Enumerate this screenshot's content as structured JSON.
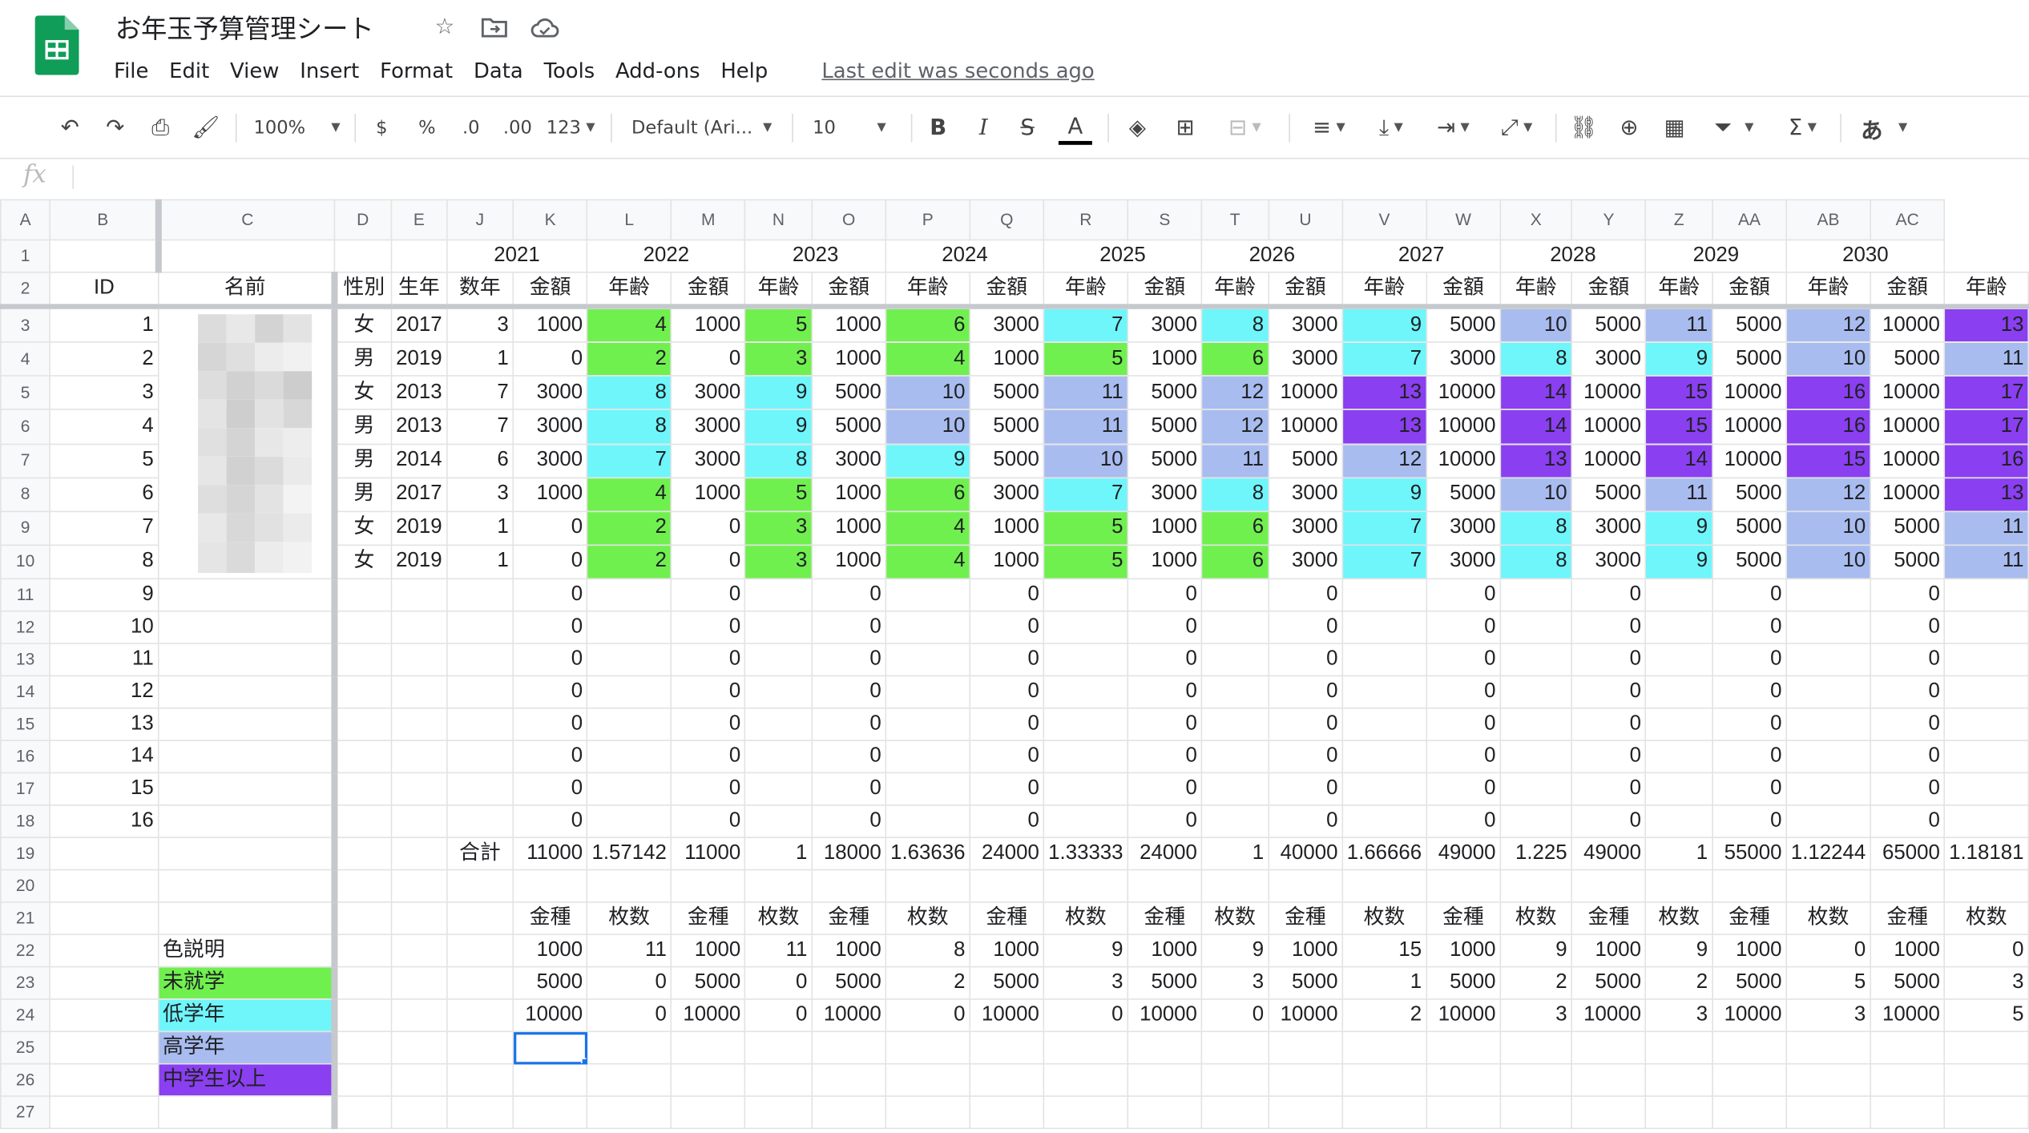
{
  "app": {
    "title": "お年玉予算管理シート",
    "menu": [
      "File",
      "Edit",
      "View",
      "Insert",
      "Format",
      "Data",
      "Tools",
      "Add-ons",
      "Help"
    ],
    "last_edit": "Last edit was seconds ago"
  },
  "toolbar": {
    "zoom": "100%",
    "currency": "$",
    "percent": "%",
    "dec_less": ".0",
    "dec_more": ".00",
    "more_formats": "123",
    "font": "Default (Ari...",
    "font_size": "10",
    "bold": "B",
    "italic": "I",
    "strike": "S",
    "text_color": "A",
    "input_tools": "あ"
  },
  "formula_bar": {
    "fx": "fx",
    "value": ""
  },
  "colors": {
    "未就学": "#70f04e",
    "低学年": "#6ef6fb",
    "高学年": "#a9bcf0",
    "中学生以上": "#8a3ff0",
    "selection": "#1a73e8",
    "sheets_green": "#0f9d58"
  },
  "grid": {
    "columns": [
      "A",
      "B",
      "C",
      "D",
      "E",
      "J",
      "K",
      "L",
      "M",
      "N",
      "O",
      "P",
      "Q",
      "R",
      "S",
      "T",
      "U",
      "V",
      "W",
      "X",
      "Y",
      "Z",
      "AA",
      "AB",
      "AC"
    ],
    "row_numbers": [
      "1",
      "2",
      "3",
      "4",
      "5",
      "6",
      "7",
      "8",
      "9",
      "10",
      "11",
      "12",
      "13",
      "14",
      "15",
      "16",
      "17",
      "18",
      "19",
      "20",
      "21",
      "22",
      "23",
      "24",
      "25",
      "26",
      "27"
    ],
    "years": [
      "2021",
      "2022",
      "2023",
      "2024",
      "2025",
      "2026",
      "2027",
      "2028",
      "2029",
      "2030"
    ],
    "header": {
      "id": "ID",
      "name": "名前",
      "gender": "性別",
      "birth": "生年",
      "age": "数年",
      "amount": "金額",
      "years_old": "年齢"
    },
    "people": [
      {
        "id": "1",
        "gender": "女",
        "birth": "2017",
        "age": "3",
        "cells": [
          [
            "1000",
            "4",
            "g"
          ],
          [
            "1000",
            "5",
            "g"
          ],
          [
            "1000",
            "6",
            "g"
          ],
          [
            "3000",
            "7",
            "c"
          ],
          [
            "3000",
            "8",
            "c"
          ],
          [
            "3000",
            "9",
            "c"
          ],
          [
            "5000",
            "10",
            "b"
          ],
          [
            "5000",
            "11",
            "b"
          ],
          [
            "5000",
            "12",
            "b"
          ],
          [
            "10000",
            "13",
            "p"
          ]
        ]
      },
      {
        "id": "2",
        "gender": "男",
        "birth": "2019",
        "age": "1",
        "cells": [
          [
            "0",
            "2",
            "g"
          ],
          [
            "0",
            "3",
            "g"
          ],
          [
            "1000",
            "4",
            "g"
          ],
          [
            "1000",
            "5",
            "g"
          ],
          [
            "1000",
            "6",
            "g"
          ],
          [
            "3000",
            "7",
            "c"
          ],
          [
            "3000",
            "8",
            "c"
          ],
          [
            "3000",
            "9",
            "c"
          ],
          [
            "5000",
            "10",
            "b"
          ],
          [
            "5000",
            "11",
            "b"
          ]
        ]
      },
      {
        "id": "3",
        "gender": "女",
        "birth": "2013",
        "age": "7",
        "cells": [
          [
            "3000",
            "8",
            "c"
          ],
          [
            "3000",
            "9",
            "c"
          ],
          [
            "5000",
            "10",
            "b"
          ],
          [
            "5000",
            "11",
            "b"
          ],
          [
            "5000",
            "12",
            "b"
          ],
          [
            "10000",
            "13",
            "p"
          ],
          [
            "10000",
            "14",
            "p"
          ],
          [
            "10000",
            "15",
            "p"
          ],
          [
            "10000",
            "16",
            "p"
          ],
          [
            "10000",
            "17",
            "p"
          ]
        ]
      },
      {
        "id": "4",
        "gender": "男",
        "birth": "2013",
        "age": "7",
        "cells": [
          [
            "3000",
            "8",
            "c"
          ],
          [
            "3000",
            "9",
            "c"
          ],
          [
            "5000",
            "10",
            "b"
          ],
          [
            "5000",
            "11",
            "b"
          ],
          [
            "5000",
            "12",
            "b"
          ],
          [
            "10000",
            "13",
            "p"
          ],
          [
            "10000",
            "14",
            "p"
          ],
          [
            "10000",
            "15",
            "p"
          ],
          [
            "10000",
            "16",
            "p"
          ],
          [
            "10000",
            "17",
            "p"
          ]
        ]
      },
      {
        "id": "5",
        "gender": "男",
        "birth": "2014",
        "age": "6",
        "cells": [
          [
            "3000",
            "7",
            "c"
          ],
          [
            "3000",
            "8",
            "c"
          ],
          [
            "3000",
            "9",
            "c"
          ],
          [
            "5000",
            "10",
            "b"
          ],
          [
            "5000",
            "11",
            "b"
          ],
          [
            "5000",
            "12",
            "b"
          ],
          [
            "10000",
            "13",
            "p"
          ],
          [
            "10000",
            "14",
            "p"
          ],
          [
            "10000",
            "15",
            "p"
          ],
          [
            "10000",
            "16",
            "p"
          ]
        ]
      },
      {
        "id": "6",
        "gender": "男",
        "birth": "2017",
        "age": "3",
        "cells": [
          [
            "1000",
            "4",
            "g"
          ],
          [
            "1000",
            "5",
            "g"
          ],
          [
            "1000",
            "6",
            "g"
          ],
          [
            "3000",
            "7",
            "c"
          ],
          [
            "3000",
            "8",
            "c"
          ],
          [
            "3000",
            "9",
            "c"
          ],
          [
            "5000",
            "10",
            "b"
          ],
          [
            "5000",
            "11",
            "b"
          ],
          [
            "5000",
            "12",
            "b"
          ],
          [
            "10000",
            "13",
            "p"
          ]
        ]
      },
      {
        "id": "7",
        "gender": "女",
        "birth": "2019",
        "age": "1",
        "cells": [
          [
            "0",
            "2",
            "g"
          ],
          [
            "0",
            "3",
            "g"
          ],
          [
            "1000",
            "4",
            "g"
          ],
          [
            "1000",
            "5",
            "g"
          ],
          [
            "1000",
            "6",
            "g"
          ],
          [
            "3000",
            "7",
            "c"
          ],
          [
            "3000",
            "8",
            "c"
          ],
          [
            "3000",
            "9",
            "c"
          ],
          [
            "5000",
            "10",
            "b"
          ],
          [
            "5000",
            "11",
            "b"
          ]
        ]
      },
      {
        "id": "8",
        "gender": "女",
        "birth": "2019",
        "age": "1",
        "cells": [
          [
            "0",
            "2",
            "g"
          ],
          [
            "0",
            "3",
            "g"
          ],
          [
            "1000",
            "4",
            "g"
          ],
          [
            "1000",
            "5",
            "g"
          ],
          [
            "1000",
            "6",
            "g"
          ],
          [
            "3000",
            "7",
            "c"
          ],
          [
            "3000",
            "8",
            "c"
          ],
          [
            "3000",
            "9",
            "c"
          ],
          [
            "5000",
            "10",
            "b"
          ],
          [
            "5000",
            "11",
            "b"
          ]
        ]
      }
    ],
    "empty_ids": [
      "9",
      "10",
      "11",
      "12",
      "13",
      "14",
      "15",
      "16"
    ],
    "empty_value": "0",
    "total_label": "合計",
    "totals": [
      [
        "11000",
        "1.57142"
      ],
      [
        "11000",
        "1"
      ],
      [
        "18000",
        "1.63636"
      ],
      [
        "24000",
        "1.33333"
      ],
      [
        "24000",
        "1"
      ],
      [
        "40000",
        "1.66666"
      ],
      [
        "49000",
        "1.225"
      ],
      [
        "49000",
        "1"
      ],
      [
        "55000",
        "1.12244"
      ],
      [
        "65000",
        "1.18181"
      ]
    ],
    "denom_header": {
      "kind": "金種",
      "count": "枚数"
    },
    "denoms": [
      {
        "value": "1000",
        "counts": [
          "11",
          "11",
          "8",
          "9",
          "9",
          "15",
          "9",
          "9",
          "0",
          "0"
        ]
      },
      {
        "value": "5000",
        "counts": [
          "0",
          "0",
          "2",
          "3",
          "3",
          "1",
          "2",
          "2",
          "5",
          "3"
        ]
      },
      {
        "value": "10000",
        "counts": [
          "0",
          "0",
          "0",
          "0",
          "0",
          "2",
          "3",
          "3",
          "3",
          "5"
        ]
      }
    ],
    "legend_title": "色説明",
    "legend": [
      {
        "label": "未就学",
        "cls": "c-g"
      },
      {
        "label": "低学年",
        "cls": "c-c"
      },
      {
        "label": "高学年",
        "cls": "c-b"
      },
      {
        "label": "中学生以上",
        "cls": "c-p"
      }
    ]
  }
}
